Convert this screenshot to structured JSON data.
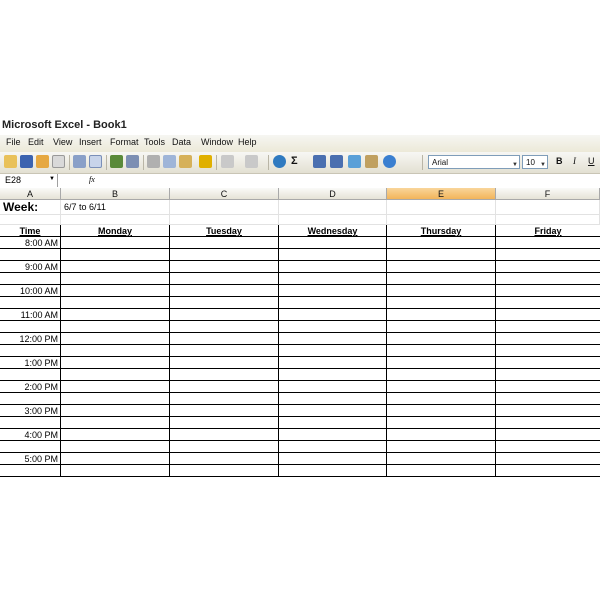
{
  "window": {
    "title": "Microsoft Excel - Book1"
  },
  "menu": [
    "File",
    "Edit",
    "View",
    "Insert",
    "Format",
    "Tools",
    "Data",
    "Window",
    "Help"
  ],
  "toolbar": {
    "font": "Arial",
    "size": "10",
    "bold": "B",
    "italic": "I",
    "underline": "U",
    "sigma": "Σ"
  },
  "formula_bar": {
    "name_box": "E28",
    "fx": "fx",
    "value": ""
  },
  "columns": [
    "A",
    "B",
    "C",
    "D",
    "E",
    "F"
  ],
  "selected_column": "E",
  "sheet": {
    "week_label": "Week:",
    "week_value": "6/7 to 6/11",
    "headers": [
      "Time",
      "Monday",
      "Tuesday",
      "Wednesday",
      "Thursday",
      "Friday"
    ],
    "times": [
      "8:00 AM",
      "9:00 AM",
      "10:00 AM",
      "11:00 AM",
      "12:00 PM",
      "1:00 PM",
      "2:00 PM",
      "3:00 PM",
      "4:00 PM",
      "5:00 PM"
    ]
  }
}
